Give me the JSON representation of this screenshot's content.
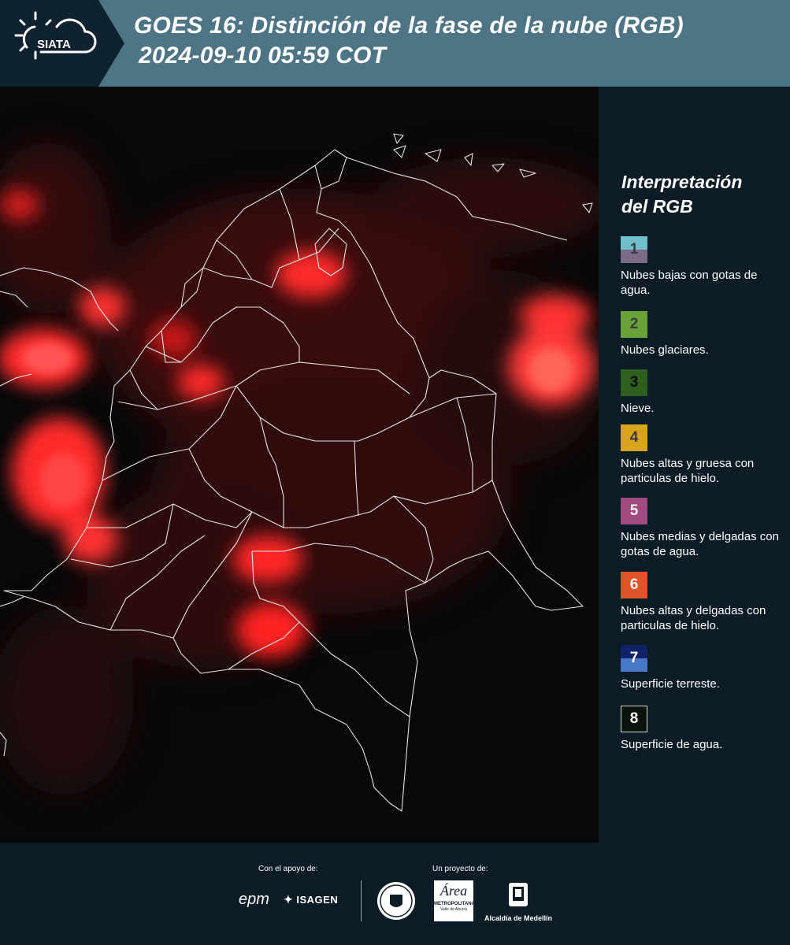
{
  "header": {
    "title_line1": "GOES 16: Distinción de la fase de la nube (RGB)",
    "title_line2": "2024-09-10 05:59 COT",
    "logo_text": "SIATA"
  },
  "legend": {
    "title_line1": "Interpretación",
    "title_line2": "del RGB",
    "items": [
      {
        "num": "1",
        "desc": "Nubes bajas con gotas de agua.",
        "color": "#6fbfcc",
        "color2": "#7a6c86"
      },
      {
        "num": "2",
        "desc": "Nubes glaciares.",
        "color": "#6aa23a"
      },
      {
        "num": "3",
        "desc": "Nieve.",
        "color": "#2f5f1f"
      },
      {
        "num": "4",
        "desc": "Nubes altas y gruesa con particulas de hielo.",
        "color": "#d8a41c"
      },
      {
        "num": "5",
        "desc": "Nubes medias y delgadas con gotas de agua.",
        "color": "#a14a80"
      },
      {
        "num": "6",
        "desc": "Nubes altas y delgadas con particulas de hielo.",
        "color": "#e0542c"
      },
      {
        "num": "7",
        "desc": "Superficie terreste.",
        "color": "#0f2266",
        "color2": "#4a78c8"
      },
      {
        "num": "8",
        "desc": "Superficie de agua.",
        "color": "#0a120c"
      }
    ]
  },
  "footer": {
    "support_label": "Con el apoyo de:",
    "project_label": "Un proyecto de:",
    "sponsors": {
      "epm": "epm",
      "isagen": "ISAGEN",
      "area_line1": "Área",
      "area_line2": "METROPOLITANA",
      "area_line3": "Valle de Aburrá",
      "alcaldia": "Alcaldía de Medellín"
    }
  }
}
